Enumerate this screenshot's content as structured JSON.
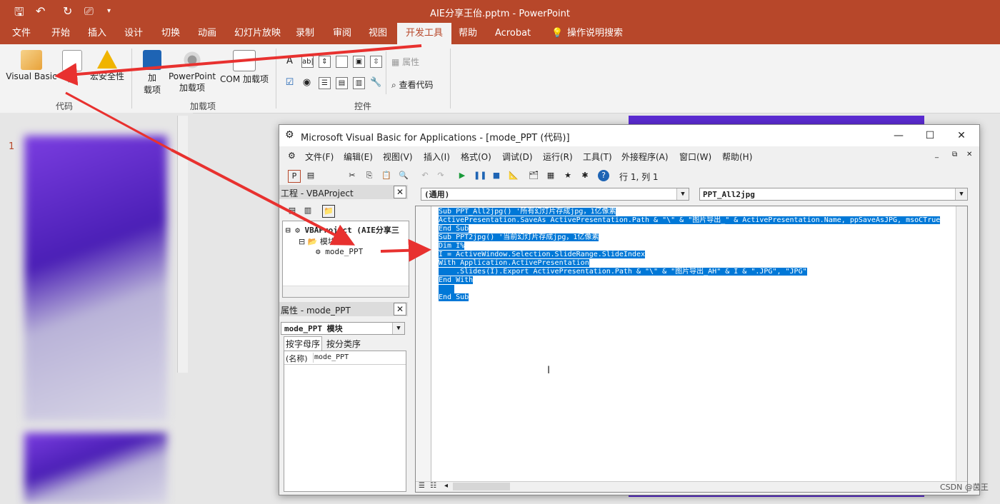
{
  "ppt": {
    "title": "AIE分享王佁.pptm  -  PowerPoint",
    "tabs": [
      "文件",
      "开始",
      "插入",
      "设计",
      "切换",
      "动画",
      "幻灯片放映",
      "录制",
      "审阅",
      "视图",
      "开发工具",
      "帮助",
      "Acrobat",
      "操作说明搜索"
    ],
    "active_tab": "开发工具",
    "ribbon": {
      "visual_basic": "Visual Basic",
      "macro": "宏",
      "macro_security": "宏安全性",
      "group_code": "代码",
      "addins": "加\n载项",
      "addins_line1": "加",
      "addins_line2": "载项",
      "ppt_addins_line1": "PowerPoint",
      "ppt_addins_line2": "加载项",
      "com_addins": "COM 加载项",
      "group_addins": "加载项",
      "properties": "属性",
      "view_code": "查看代码",
      "group_controls": "控件"
    },
    "slide_number": "1"
  },
  "vba": {
    "title": "Microsoft Visual Basic for Applications - [mode_PPT (代码)]",
    "menu": [
      "文件(F)",
      "编辑(E)",
      "视图(V)",
      "插入(I)",
      "格式(O)",
      "调试(D)",
      "运行(R)",
      "工具(T)",
      "外接程序(A)",
      "窗口(W)",
      "帮助(H)"
    ],
    "position": "行 1, 列 1",
    "project_title": "工程 - VBAProject",
    "tree_root": "VBAProject (AIE分享三",
    "tree_folder": "模块",
    "tree_module": "mode_PPT",
    "props_title": "属性 - mode_PPT",
    "props_object": "mode_PPT 模块",
    "props_tab_alpha": "按字母序",
    "props_tab_cat": "按分类序",
    "props_name_key": "(名称)",
    "props_name_val": "mode_PPT",
    "combo_object": "(通用)",
    "combo_proc": "PPT_All2jpg",
    "code": [
      "Sub PPT_All2jpg() '所有幻灯片存成jpg，1亿像素",
      "ActivePresentation.SaveAs ActivePresentation.Path & \"\\\" & \"图片导出_\" & ActivePresentation.Name, ppSaveAsJPG, msoCTrue",
      "End Sub",
      "Sub PPT2jpg() '当前幻灯片存成jpg，1亿像素",
      "Dim I%",
      "I = ActiveWindow.Selection.SlideRange.SlideIndex",
      "With Application.ActivePresentation",
      "    .Slides(I).Export ActivePresentation.Path & \"\\\" & \"图片导出_AH\" & I & \".JPG\", \"JPG\"",
      "End With",
      "",
      "End Sub"
    ]
  },
  "watermark": "CSDN @茵王",
  "colors": {
    "ppt_red": "#b7472a",
    "selection": "#0078d7",
    "arrow": "#e8312f"
  },
  "icons": [
    "save-icon",
    "undo-icon",
    "redo-icon",
    "present-icon",
    "visual-basic-icon",
    "macro-icon",
    "macro-security-icon",
    "addins-icon",
    "ppt-addins-icon",
    "com-addins-icon",
    "lightbulb-icon",
    "vba-app-icon",
    "close-icon",
    "maximize-icon",
    "minimize-icon",
    "run-icon",
    "pause-icon",
    "stop-icon",
    "help-icon"
  ]
}
